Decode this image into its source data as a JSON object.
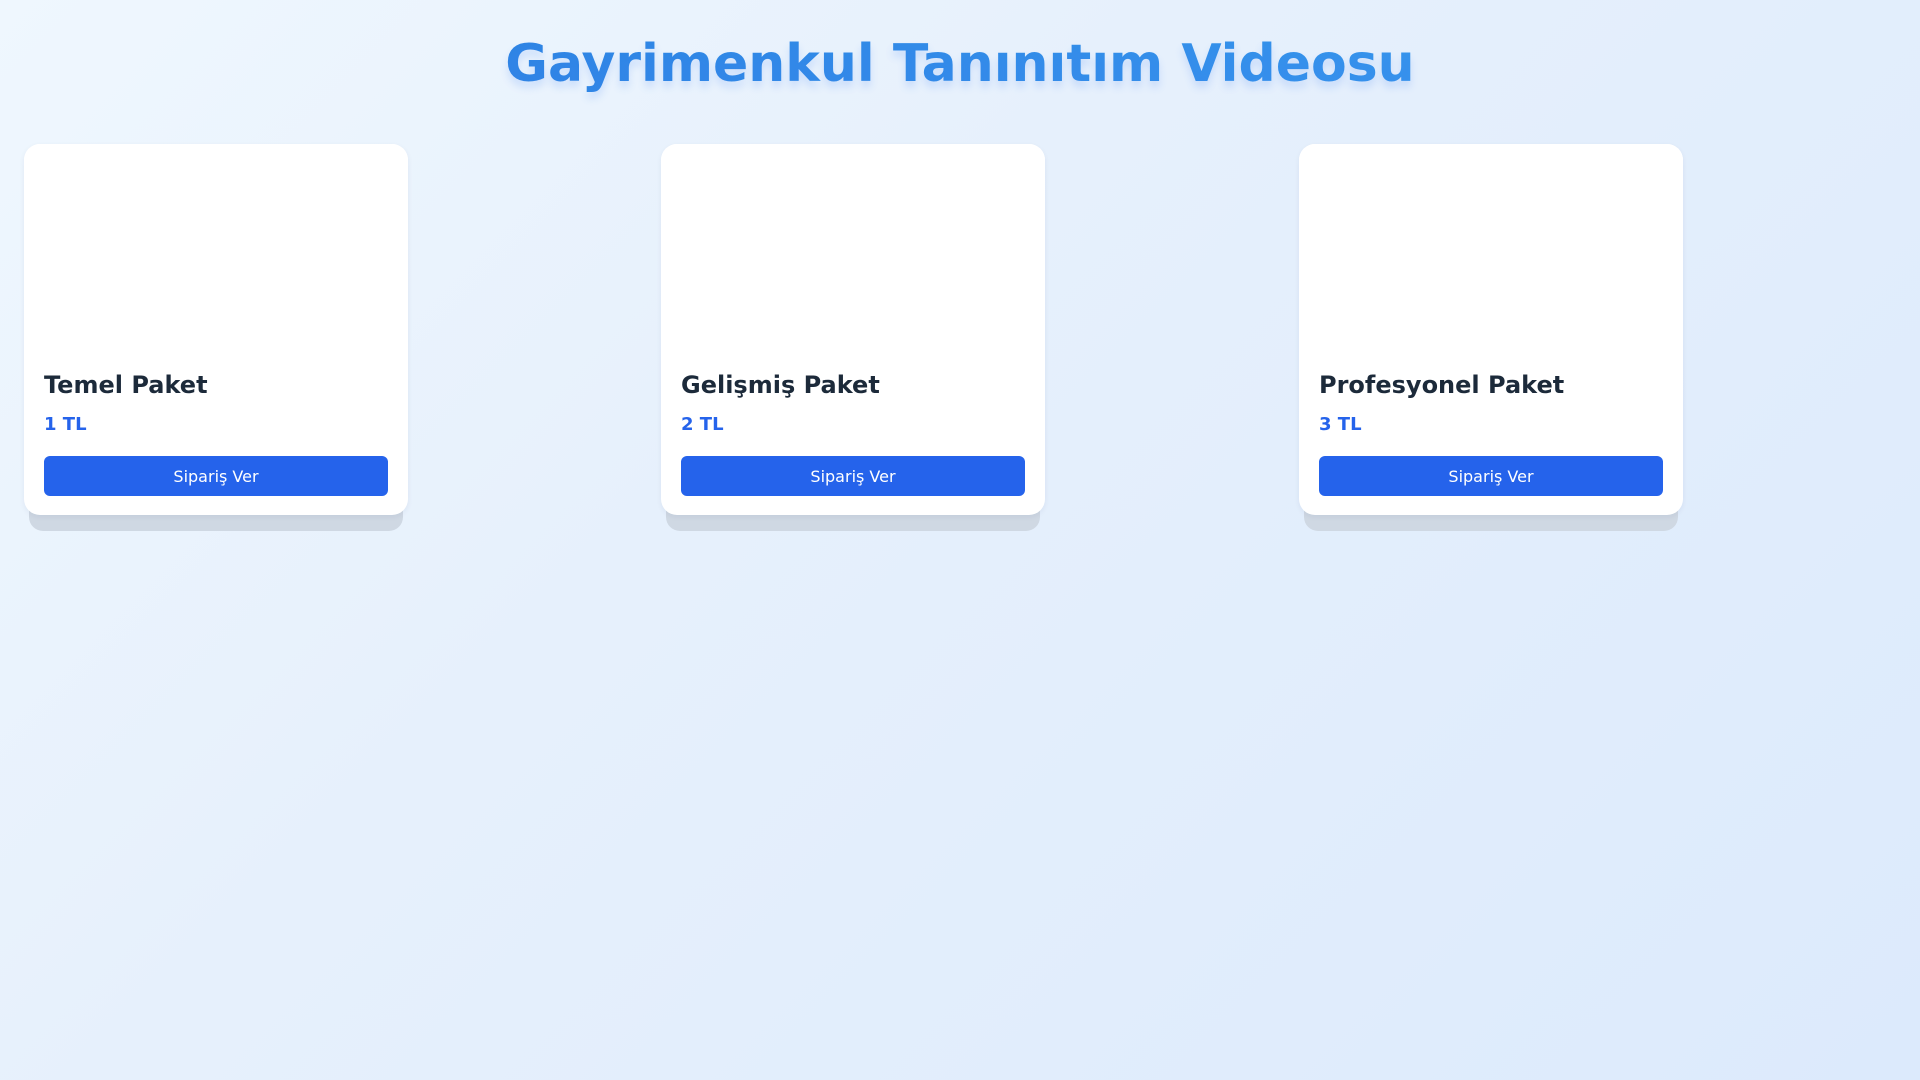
{
  "page": {
    "title": "Gayrimenkul Tanınıtım Videosu"
  },
  "packages": [
    {
      "name": "Temel Paket",
      "price": "1 TL",
      "button_label": "Sipariş Ver"
    },
    {
      "name": "Gelişmiş Paket",
      "price": "2 TL",
      "button_label": "Sipariş Ver"
    },
    {
      "name": "Profesyonel Paket",
      "price": "3 TL",
      "button_label": "Sipariş Ver"
    }
  ],
  "colors": {
    "accent": "#2563eb",
    "title_gradient_start": "#2b7de0",
    "title_gradient_end": "#3a9cf0",
    "card_title": "#1c2a3a",
    "card_background": "#ffffff"
  }
}
